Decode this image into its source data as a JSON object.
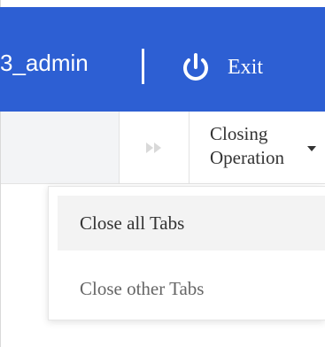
{
  "header": {
    "username": "3_admin",
    "exit_label": "Exit",
    "icons": {
      "power": "power-icon"
    }
  },
  "tabbar": {
    "scroll_icon": "double-chevron-right-icon",
    "closing_operation_label": "Closing Operation",
    "dropdown_icon": "caret-down-icon"
  },
  "dropdown": {
    "items": [
      {
        "label": "Close all Tabs"
      },
      {
        "label": "Close other Tabs"
      }
    ]
  },
  "colors": {
    "header_bg": "#2d5fd3",
    "tab_left_bg": "#f3f4f6",
    "hover_bg": "#f3f3f3",
    "scroll_icon_color": "#d9d9d9"
  }
}
